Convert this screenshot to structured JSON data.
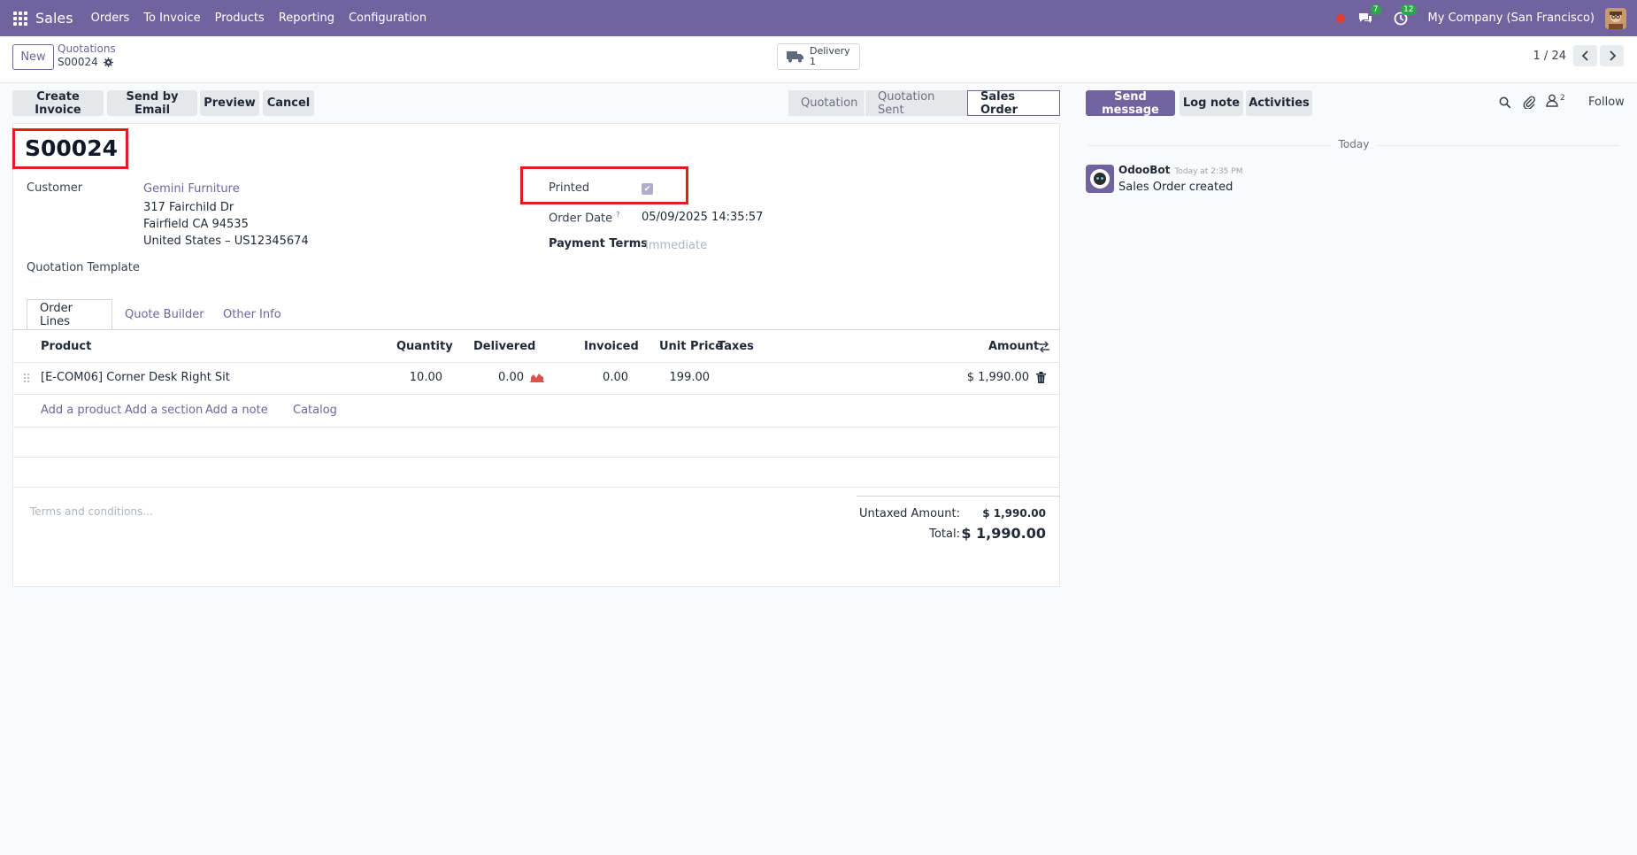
{
  "topbar": {
    "app_name": "Sales",
    "menu": [
      "Orders",
      "To Invoice",
      "Products",
      "Reporting",
      "Configuration"
    ],
    "messages_badge": "7",
    "activities_badge": "12",
    "company": "My Company (San Francisco)"
  },
  "breadcrumb": {
    "new_label": "New",
    "parent": "Quotations",
    "current": "S00024"
  },
  "smart_button": {
    "label": "Delivery",
    "count": "1"
  },
  "pager": {
    "text": "1 / 24"
  },
  "actions": [
    "Create Invoice",
    "Send by Email",
    "Preview",
    "Cancel"
  ],
  "status_steps": [
    "Quotation",
    "Quotation Sent",
    "Sales Order"
  ],
  "status_active": "Sales Order",
  "form": {
    "title": "S00024",
    "customer_label": "Customer",
    "customer_name": "Gemini Furniture",
    "address_line1": "317 Fairchild Dr",
    "address_line2": "Fairfield CA 94535",
    "address_line3": "United States – US12345674",
    "template_label": "Quotation Template",
    "printed_label": "Printed",
    "printed_checked": true,
    "order_date_label": "Order Date",
    "order_date_help": "?",
    "order_date": "05/09/2025 14:35:57",
    "payment_terms_label": "Payment Terms",
    "payment_terms_placeholder": "Immediate"
  },
  "tabs": [
    "Order Lines",
    "Quote Builder",
    "Other Info"
  ],
  "table": {
    "headers": [
      "Product",
      "Quantity",
      "Delivered",
      "Invoiced",
      "Unit Price",
      "Taxes",
      "Amount"
    ],
    "rows": [
      {
        "product": "[E-COM06] Corner Desk Right Sit",
        "quantity": "10.00",
        "delivered": "0.00",
        "invoiced": "0.00",
        "unit_price": "199.00",
        "taxes": "",
        "amount": "$ 1,990.00"
      }
    ],
    "add_links": [
      "Add a product",
      "Add a section",
      "Add a note",
      "Catalog"
    ]
  },
  "terms_placeholder": "Terms and conditions...",
  "totals": {
    "untaxed_label": "Untaxed Amount:",
    "untaxed_value": "$ 1,990.00",
    "total_label": "Total:",
    "total_value": "$ 1,990.00"
  },
  "chatter": {
    "send_message": "Send message",
    "log_note": "Log note",
    "activities": "Activities",
    "followers_count": "2",
    "follow": "Follow",
    "today": "Today",
    "author": "OdooBot",
    "time": "Today at 2:35 PM",
    "message": "Sales Order created"
  },
  "colors": {
    "brand": "#71639e",
    "highlight": "#e41b1b"
  }
}
